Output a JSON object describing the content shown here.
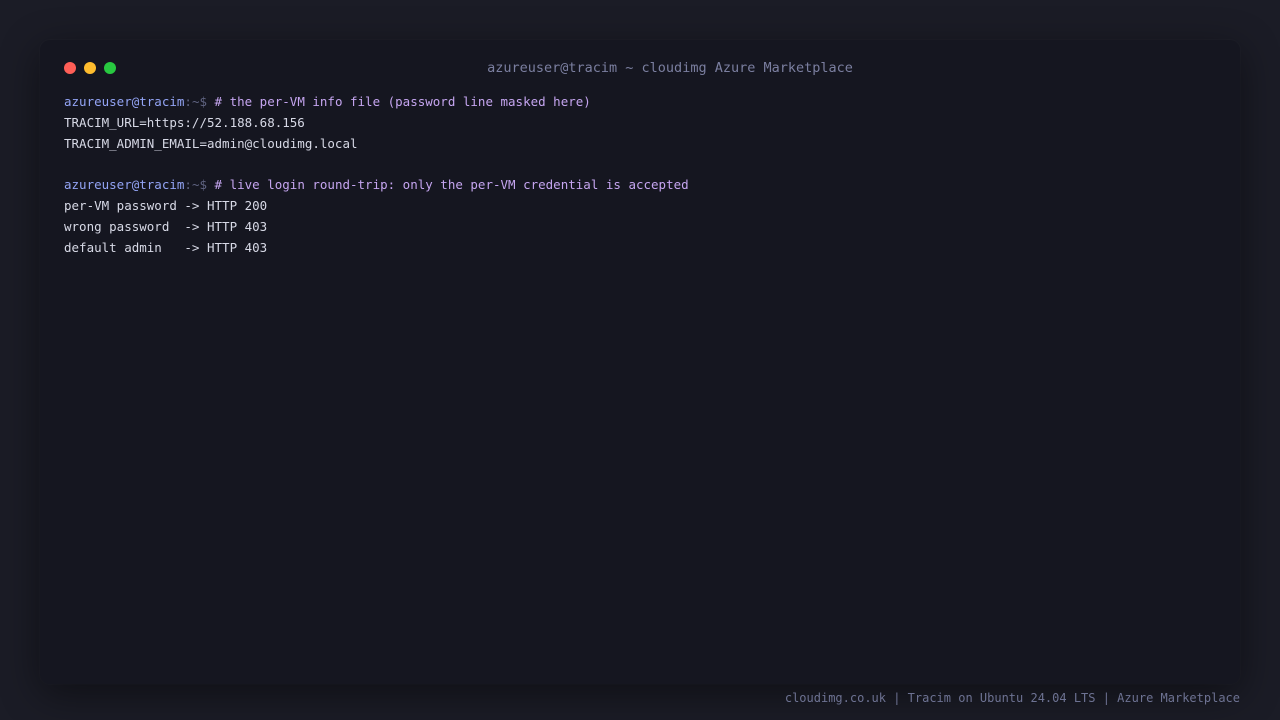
{
  "window": {
    "title": "azureuser@tracim ~ cloudimg Azure Marketplace",
    "traffic_lights": {
      "close_color": "#ff5f57",
      "minimize_color": "#febc2e",
      "maximize_color": "#28c840"
    }
  },
  "terminal": {
    "prompt_user": "azureuser@tracim",
    "prompt_path": ":~$ ",
    "blocks": [
      {
        "command": "# the per-VM info file (password line masked here)",
        "output": [
          "TRACIM_URL=https://52.188.68.156",
          "TRACIM_ADMIN_EMAIL=admin@cloudimg.local"
        ]
      },
      {
        "command": "# live login round-trip: only the per-VM credential is accepted",
        "output": [
          "per-VM password -> HTTP 200",
          "wrong password  -> HTTP 403",
          "default admin   -> HTTP 403"
        ]
      }
    ]
  },
  "footer": {
    "text": "cloudimg.co.uk | Tracim on Ubuntu 24.04 LTS | Azure Marketplace"
  },
  "colors": {
    "background": "#1b1c26",
    "terminal_background": "#151620",
    "prompt_user": "#93a4f5",
    "comment": "#c5a5f0",
    "output_text": "#d7d9e6"
  }
}
